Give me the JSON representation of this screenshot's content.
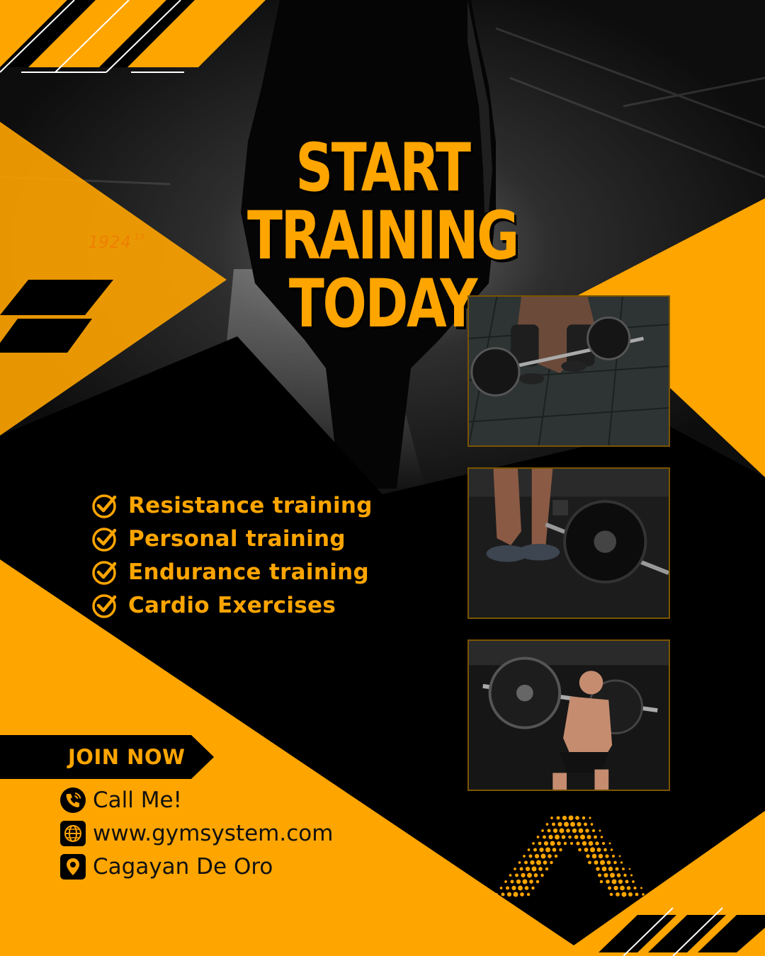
{
  "poster": {
    "title_line1": "START TRAINING",
    "title_line2": "TODAY",
    "clock_main": "1924",
    "clock_sup": "13"
  },
  "features": [
    {
      "label": "Resistance training",
      "icon": "check-circle-icon"
    },
    {
      "label": "Personal training",
      "icon": "check-circle-icon"
    },
    {
      "label": "Endurance training",
      "icon": "check-circle-icon"
    },
    {
      "label": "Cardio Exercises",
      "icon": "check-circle-icon"
    }
  ],
  "cta": {
    "join_label": "JOIN NOW"
  },
  "contact": {
    "phone": {
      "label": "Call Me!",
      "icon": "phone-icon"
    },
    "website": {
      "label": "www.gymsystem.com",
      "icon": "globe-icon"
    },
    "location": {
      "label": "Cagayan De Oro",
      "icon": "location-pin-icon"
    }
  },
  "photos": [
    {
      "name": "deadlift-photo-1",
      "subject": "barbell deadlift floor view"
    },
    {
      "name": "deadlift-photo-2",
      "subject": "barbell plate close-up"
    },
    {
      "name": "squat-photo",
      "subject": "athlete barbell squat"
    }
  ],
  "colors": {
    "accent": "#FFA500",
    "background": "#000000",
    "text_dark": "#111111"
  }
}
